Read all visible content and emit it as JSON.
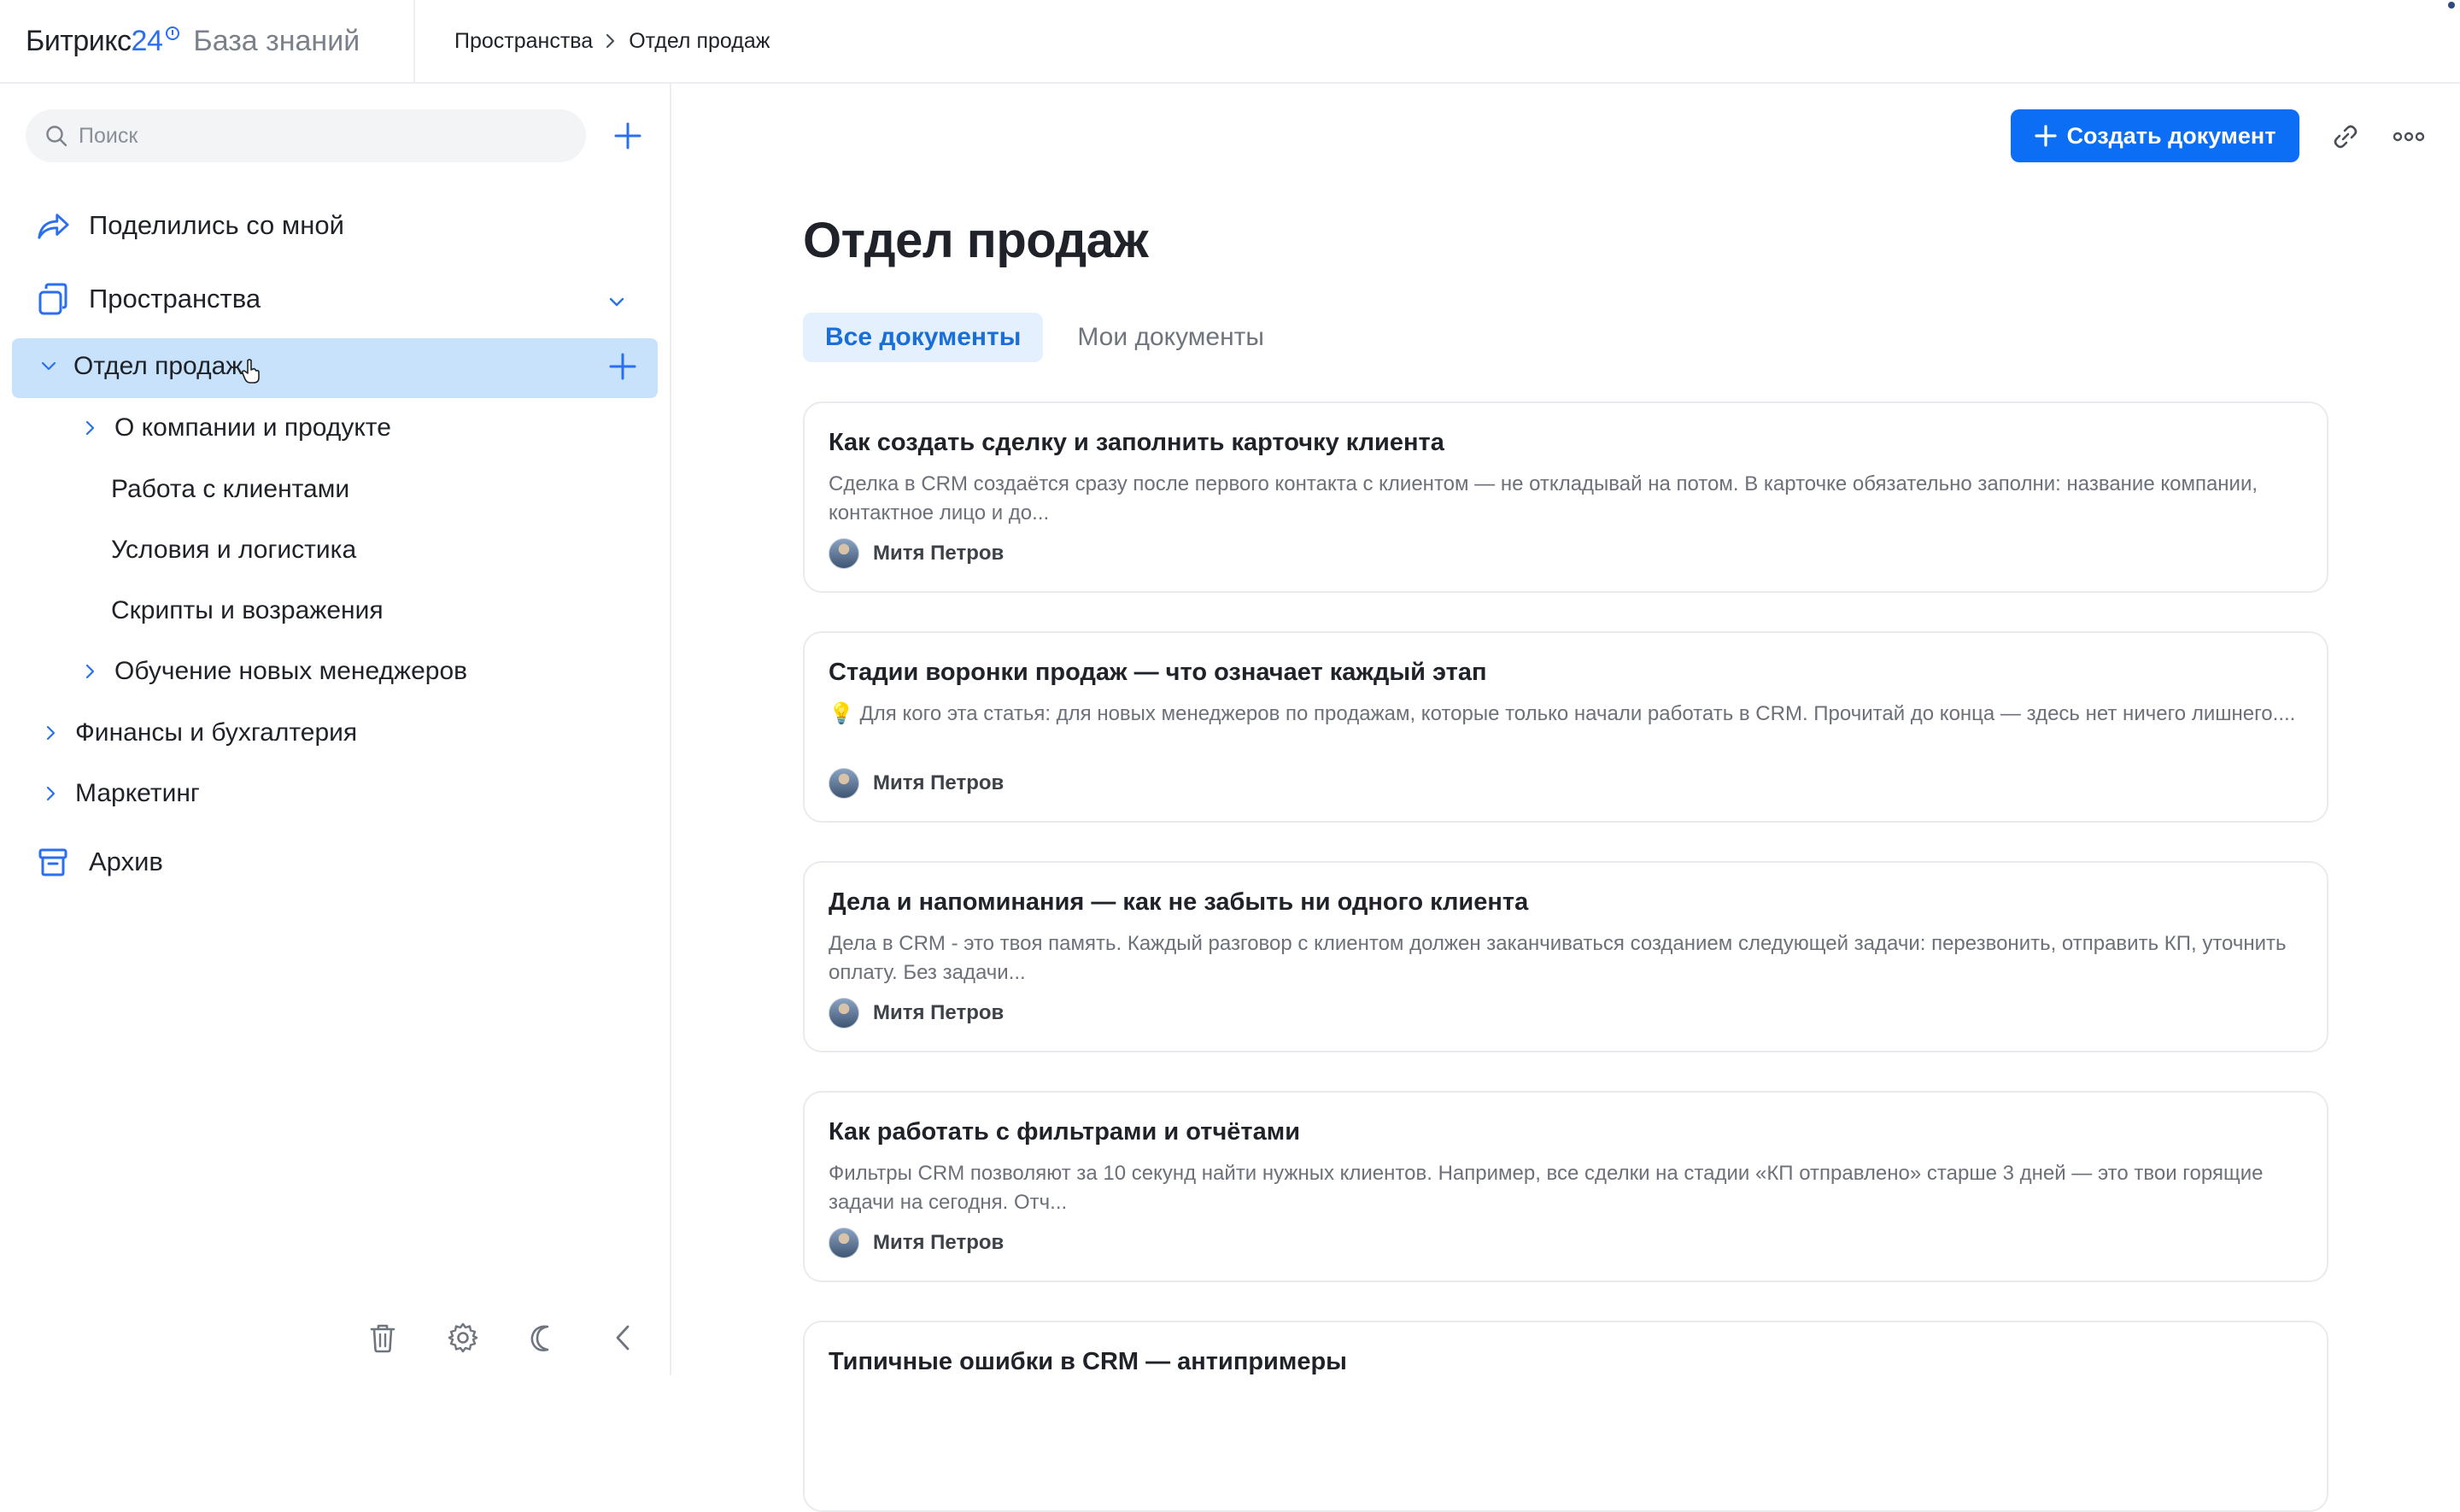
{
  "header": {
    "brand_name": "Битрикс",
    "brand_number": "24",
    "section_title": "База знаний",
    "breadcrumbs": [
      "Пространства",
      "Отдел продаж"
    ]
  },
  "sidebar": {
    "search_placeholder": "Поиск",
    "shared_label": "Поделились со мной",
    "spaces_label": "Пространства",
    "tree": {
      "root_label": "Отдел продаж",
      "children": [
        "О компании и продукте",
        "Работа с клиентами",
        "Условия и логистика",
        "Скрипты и возражения",
        "Обучение новых менеджеров"
      ],
      "siblings": [
        "Финансы и бухгалтерия",
        "Маркетинг"
      ]
    },
    "archive_label": "Архив"
  },
  "main": {
    "create_button_label": "Создать документ",
    "page_title": "Отдел продаж",
    "tabs": [
      {
        "label": "Все документы",
        "active": true
      },
      {
        "label": "Мои документы",
        "active": false
      }
    ],
    "documents": [
      {
        "title": "Как создать сделку и заполнить карточку клиента",
        "snippet": "Сделка в CRM создаётся сразу после первого контакта с клиентом — не откладывай на потом. В карточке обязательно заполни: название компании, контактное лицо и до...",
        "author": "Митя Петров"
      },
      {
        "title": "Стадии воронки продаж — что означает каждый этап",
        "snippet": "💡 Для кого эта статья: для новых менеджеров по продажам, которые только начали работать в CRM. Прочитай до конца — здесь нет ничего лишнего....",
        "author": "Митя Петров"
      },
      {
        "title": "Дела и напоминания — как не забыть ни одного клиента",
        "snippet": "Дела в CRM - это твоя память. Каждый разговор с клиентом должен заканчиваться созданием следующей задачи: перезвонить, отправить КП, уточнить оплату. Без задачи...",
        "author": "Митя Петров"
      },
      {
        "title": "Как работать с фильтрами и отчётами",
        "snippet": "Фильтры CRM позволяют за 10 секунд найти нужных клиентов. Например, все сделки на стадии «КП отправлено» старше 3 дней — это твои горящие задачи на сегодня. Отч...",
        "author": "Митя Петров"
      },
      {
        "title": "Типичные ошибки в CRM — антипримеры",
        "snippet": "",
        "author": ""
      }
    ]
  },
  "colors": {
    "accent": "#0b6ef5",
    "selected_row": "#c8e2fb",
    "active_tab_bg": "#e4f0fd",
    "brand_blue": "#2a6ff0"
  },
  "icons": {
    "search": "search-icon",
    "add": "plus-icon",
    "shared": "share-arrow-icon",
    "spaces": "spaces-icon",
    "archive": "archive-icon",
    "trash": "trash-icon",
    "settings": "gear-icon",
    "theme": "moon-icon",
    "collapse": "chevron-left-icon",
    "link": "link-icon",
    "more": "more-dots-icon"
  }
}
